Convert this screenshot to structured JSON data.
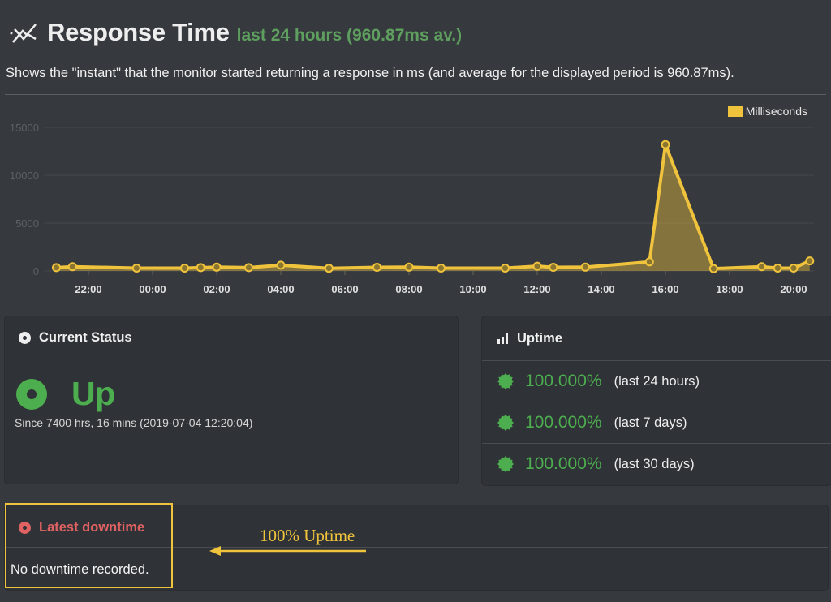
{
  "header": {
    "icon": "line-chart-icon",
    "title": "Response Time",
    "subtitle": "last 24 hours (960.87ms av.)",
    "description": "Shows the \"instant\" that the monitor started returning a response in ms (and average for the displayed period is 960.87ms)."
  },
  "colors": {
    "accent_yellow": "#f0c33c",
    "status_green": "#4cae4f",
    "subtitle_green": "#5e9e5e",
    "downtime_red": "#e06262",
    "background": "#36393e",
    "panel": "#2f3236"
  },
  "chart_data": {
    "type": "area",
    "title": "Response Time",
    "xlabel": "",
    "ylabel": "",
    "legend": [
      "Milliseconds"
    ],
    "legend_position": "top-right",
    "grid": true,
    "ylim": [
      0,
      15000
    ],
    "yticks": [
      "0",
      "5000",
      "10000",
      "15000"
    ],
    "xticks": [
      "22:00",
      "00:00",
      "02:00",
      "04:00",
      "06:00",
      "08:00",
      "10:00",
      "12:00",
      "14:00",
      "16:00",
      "18:00",
      "20:00"
    ],
    "series": [
      {
        "name": "Milliseconds",
        "x_hours_from_2100": [
          0,
          0.5,
          2.5,
          4,
          4.5,
          5,
          6,
          7,
          8.5,
          10,
          11,
          12,
          14,
          15,
          15.5,
          16.5,
          18.5,
          19,
          20.5,
          22,
          22.5,
          23,
          23.5
        ],
        "x_labels": [
          "21:00",
          "21:30",
          "23:30",
          "01:00",
          "01:30",
          "02:00",
          "03:00",
          "04:00",
          "05:30",
          "07:00",
          "08:00",
          "09:00",
          "11:00",
          "12:00",
          "12:30",
          "13:30",
          "15:30",
          "16:00",
          "17:30",
          "19:00",
          "19:30",
          "20:00",
          "20:30"
        ],
        "values": [
          350,
          450,
          300,
          300,
          350,
          400,
          350,
          600,
          280,
          380,
          400,
          300,
          300,
          500,
          380,
          400,
          950,
          13200,
          250,
          450,
          300,
          300,
          1050
        ]
      }
    ]
  },
  "current_status": {
    "title": "Current Status",
    "icon": "dot-circle-icon",
    "status": "Up",
    "status_icon": "dot-circle-icon",
    "since": "Since 7400 hrs, 16 mins (2019-07-04 12:20:04)"
  },
  "uptime": {
    "title": "Uptime",
    "icon": "bar-chart-icon",
    "rows": [
      {
        "icon": "certificate-badge-icon",
        "percent": "100.000%",
        "period": "(last 24 hours)"
      },
      {
        "icon": "certificate-badge-icon",
        "percent": "100.000%",
        "period": "(last 7 days)"
      },
      {
        "icon": "certificate-badge-icon",
        "percent": "100.000%",
        "period": "(last 30 days)"
      }
    ]
  },
  "latest_downtime": {
    "title": "Latest downtime",
    "icon": "dot-circle-icon",
    "message": "No downtime recorded."
  },
  "annotation": {
    "text": "100% Uptime",
    "arrow": "arrow-left-icon"
  }
}
